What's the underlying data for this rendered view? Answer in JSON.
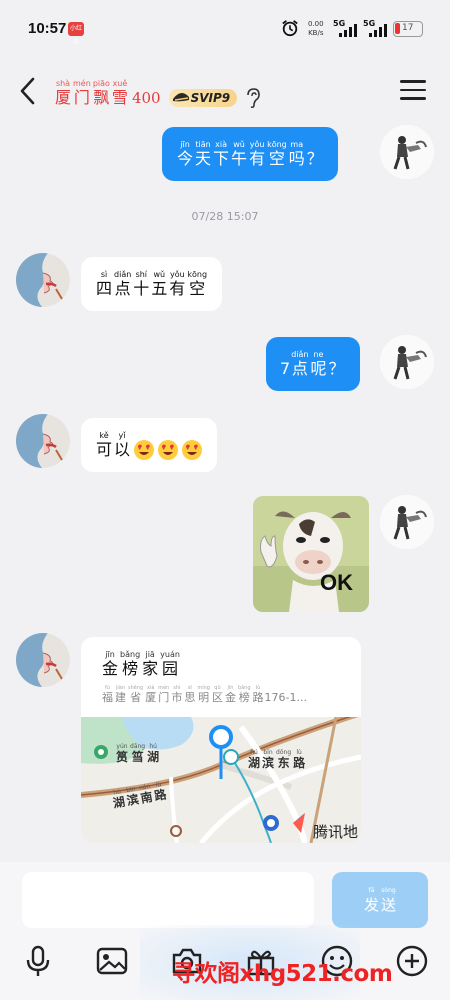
{
  "status_bar": {
    "time": "10:57",
    "app_badge": "小红书",
    "net_speed_value": "0.00",
    "net_speed_unit": "KB/s",
    "signal1_label": "5G",
    "signal2_label": "5G",
    "battery": "17",
    "battery_color": "#e33333"
  },
  "header": {
    "title_chars": [
      {
        "c": "厦",
        "p": "shà"
      },
      {
        "c": "门",
        "p": "mén"
      },
      {
        "c": "飘",
        "p": "piāo"
      },
      {
        "c": "雪",
        "p": "xuě"
      }
    ],
    "title_number": "400",
    "vip_badge": "SVIP9"
  },
  "timestamp": "07/28 15:07",
  "messages": [
    {
      "side": "out",
      "chars": [
        {
          "c": "今",
          "p": "jīn"
        },
        {
          "c": "天",
          "p": "tiān"
        },
        {
          "c": "下",
          "p": "xià"
        },
        {
          "c": "午",
          "p": "wǔ"
        },
        {
          "c": "有",
          "p": "yǒu"
        },
        {
          "c": "空",
          "p": "kōng"
        },
        {
          "c": "吗",
          "p": "ma"
        },
        {
          "c": "？",
          "p": ""
        }
      ]
    },
    {
      "side": "in",
      "chars": [
        {
          "c": "四",
          "p": "sì"
        },
        {
          "c": "点",
          "p": "diǎn"
        },
        {
          "c": "十",
          "p": "shí"
        },
        {
          "c": "五",
          "p": "wǔ"
        },
        {
          "c": "有",
          "p": "yǒu"
        },
        {
          "c": "空",
          "p": "kōng"
        }
      ]
    },
    {
      "side": "out",
      "prefix": "7",
      "chars": [
        {
          "c": "点",
          "p": "diǎn"
        },
        {
          "c": "呢",
          "p": "ne"
        },
        {
          "c": "？",
          "p": ""
        }
      ]
    },
    {
      "side": "in",
      "chars": [
        {
          "c": "可",
          "p": "kě"
        },
        {
          "c": "以",
          "p": "yǐ"
        }
      ],
      "emoji_count": 3
    },
    {
      "side": "out",
      "type": "sticker",
      "sticker_text": "OK"
    },
    {
      "side": "in",
      "type": "location"
    }
  ],
  "location": {
    "name_chars": [
      {
        "c": "金",
        "p": "jīn"
      },
      {
        "c": "榜",
        "p": "bǎng"
      },
      {
        "c": "家",
        "p": "jiā"
      },
      {
        "c": "园",
        "p": "yuán"
      }
    ],
    "addr_chars": [
      {
        "c": "福",
        "p": "fú"
      },
      {
        "c": "建",
        "p": "jiàn"
      },
      {
        "c": "省",
        "p": "shěng"
      },
      {
        "c": "厦",
        "p": "xià"
      },
      {
        "c": "门",
        "p": "mén"
      },
      {
        "c": "市",
        "p": "shì"
      },
      {
        "c": "思",
        "p": "sī"
      },
      {
        "c": "明",
        "p": "míng"
      },
      {
        "c": "区",
        "p": "qū"
      },
      {
        "c": "金",
        "p": "jīn"
      },
      {
        "c": "榜",
        "p": "bǎng"
      },
      {
        "c": "路",
        "p": "lù"
      }
    ],
    "addr_tail": "176-1...",
    "map_labels": {
      "lake": [
        {
          "c": "筼",
          "p": "yún"
        },
        {
          "c": "筜",
          "p": "dāng"
        },
        {
          "c": "湖",
          "p": "hú"
        }
      ],
      "east_road": [
        {
          "c": "湖",
          "p": "hú"
        },
        {
          "c": "滨",
          "p": "bīn"
        },
        {
          "c": "东",
          "p": "dōng"
        },
        {
          "c": "路",
          "p": "lù"
        }
      ],
      "south_road": [
        {
          "c": "湖",
          "p": "hú"
        },
        {
          "c": "滨",
          "p": "bīn"
        },
        {
          "c": "南",
          "p": "nán"
        },
        {
          "c": "路",
          "p": "lù"
        }
      ],
      "provider": "腾讯地"
    }
  },
  "composer": {
    "send_chars": [
      {
        "c": "发",
        "p": "fā"
      },
      {
        "c": "送",
        "p": "sòng"
      }
    ]
  },
  "toolbar": {
    "icons": [
      "mic-icon",
      "image-icon",
      "camera-icon",
      "gift-icon",
      "emoji-icon",
      "plus-icon"
    ]
  },
  "watermark": "寻欢阁xhg521.com"
}
